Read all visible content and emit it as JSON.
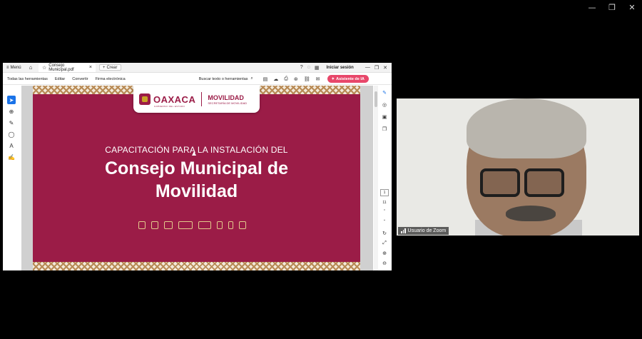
{
  "zoom_window": {
    "minimize_icon": "—",
    "restore_icon": "❐",
    "close_icon": "✕"
  },
  "acrobat": {
    "menu_label": "Menú",
    "tab_title": "Consejo Municipal.pdf",
    "create_label": "Crear",
    "sign_in": "Iniciar sesión",
    "toolbar": {
      "all_tools": "Todas las herramientas",
      "edit": "Editar",
      "convert": "Convertir",
      "esign": "Firma electrónica",
      "search": "Buscar texto o herramientas",
      "ai_assistant": "Asistente de IA"
    },
    "page_nav": {
      "current": "1",
      "total": "11"
    }
  },
  "slide": {
    "logo_oaxaca": "OAXACA",
    "logo_sub": "GOBIERNO DEL ESTADO",
    "logo_movilidad": "MOVILIDAD",
    "logo_secretaria": "SECRETARÍA DE MOVILIDAD",
    "subtitle": "CAPACITACIÓN PARA LA INSTALACIÓN DEL",
    "title_line1": "Consejo Municipal de",
    "title_line2": "Movilidad"
  },
  "participant": {
    "name": "Usuario de Zoom"
  },
  "colors": {
    "brand": "#9b1c47",
    "ai_button": "#e8476a",
    "accent_blue": "#1a73e8"
  }
}
